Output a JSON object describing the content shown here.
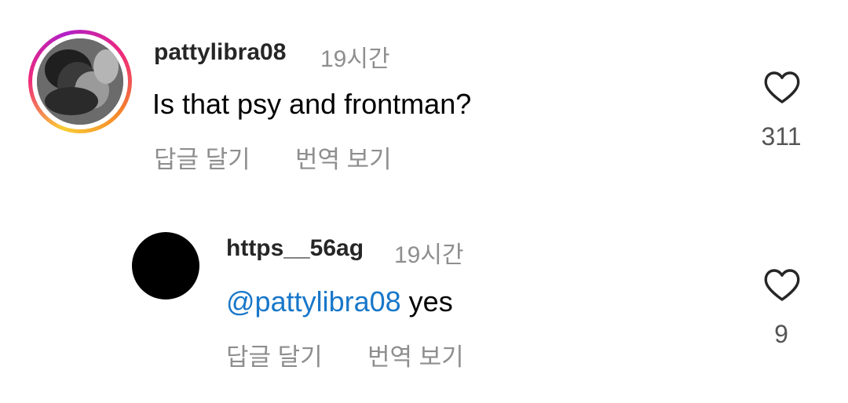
{
  "comments": [
    {
      "username": "pattylibra08",
      "time": "19시간",
      "text": "Is that psy and frontman?",
      "reply_label": "답글 달기",
      "translate_label": "번역 보기",
      "likes": "311",
      "avatar": "user-photo-with-story-ring"
    },
    {
      "username": "https__56ag",
      "time": "19시간",
      "mention": "@pattylibra08",
      "text": " yes",
      "reply_label": "답글 달기",
      "translate_label": "번역 보기",
      "likes": "9",
      "avatar": "black-circle"
    }
  ],
  "colors": {
    "mention": "#1877c9",
    "secondary_text": "#8e8e8e",
    "primary_text": "#262626"
  },
  "icons": [
    "heart-outline-icon"
  ]
}
